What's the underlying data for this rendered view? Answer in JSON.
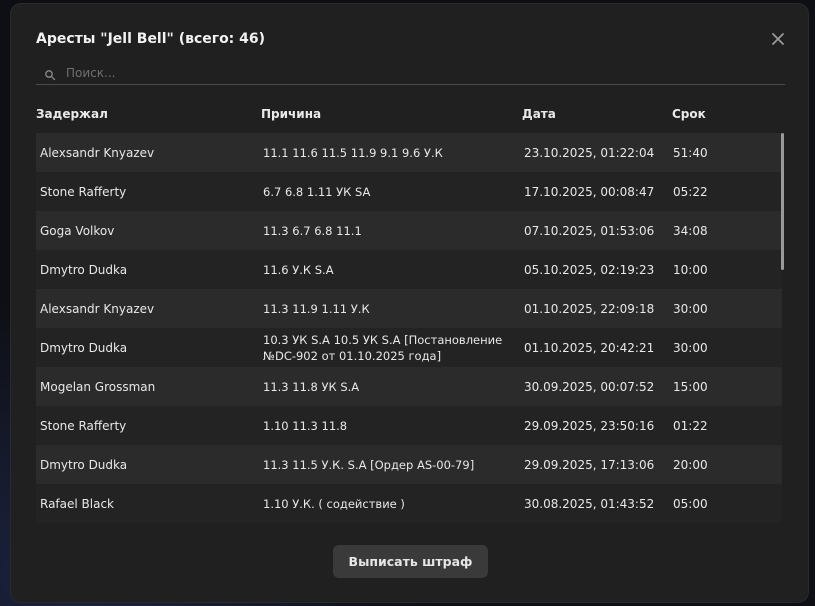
{
  "modal": {
    "title": "Аресты \"Jell Bell\" (всего: 46)",
    "search_placeholder": "Поиск...",
    "columns": {
      "detainer": "Задержал",
      "reason": "Причина",
      "date": "Дата",
      "term": "Срок"
    },
    "rows": [
      {
        "detainer": "Alexsandr Knyazev",
        "reason": "11.1 11.6 11.5 11.9 9.1 9.6 У.К",
        "date": "23.10.2025, 01:22:04",
        "term": "51:40"
      },
      {
        "detainer": "Stone Rafferty",
        "reason": "6.7 6.8 1.11 УК SA",
        "date": "17.10.2025, 00:08:47",
        "term": "05:22"
      },
      {
        "detainer": "Goga Volkov",
        "reason": "11.3 6.7 6.8 11.1",
        "date": "07.10.2025, 01:53:06",
        "term": "34:08"
      },
      {
        "detainer": "Dmytro Dudka",
        "reason": "11.6 У.К S.A",
        "date": "05.10.2025, 02:19:23",
        "term": "10:00"
      },
      {
        "detainer": "Alexsandr Knyazev",
        "reason": "11.3 11.9 1.11 У.К",
        "date": "01.10.2025, 22:09:18",
        "term": "30:00"
      },
      {
        "detainer": "Dmytro Dudka",
        "reason": "10.3 УК S.A 10.5 УК S.A [Постановление №DC-902 от 01.10.2025 года]",
        "date": "01.10.2025, 20:42:21",
        "term": "30:00"
      },
      {
        "detainer": "Mogelan Grossman",
        "reason": "11.3 11.8 УК S.A",
        "date": "30.09.2025, 00:07:52",
        "term": "15:00"
      },
      {
        "detainer": "Stone Rafferty",
        "reason": "1.10 11.3 11.8",
        "date": "29.09.2025, 23:50:16",
        "term": "01:22"
      },
      {
        "detainer": "Dmytro Dudka",
        "reason": "11.3 11.5 У.К. S.A [Ордер AS-00-79]",
        "date": "29.09.2025, 17:13:06",
        "term": "20:00"
      },
      {
        "detainer": "Rafael Black",
        "reason": "1.10 У.К. ( содействие )",
        "date": "30.08.2025, 01:43:52",
        "term": "05:00"
      }
    ],
    "fine_button_label": "Выписать штраф"
  },
  "icons": {
    "close": "close-icon",
    "search": "search-icon"
  },
  "colors": {
    "modal_bg": "#202020",
    "row_odd": "#2b2b2b",
    "row_even": "#232323",
    "button_bg": "#3a3a3a",
    "text": "#e8e8e8"
  }
}
